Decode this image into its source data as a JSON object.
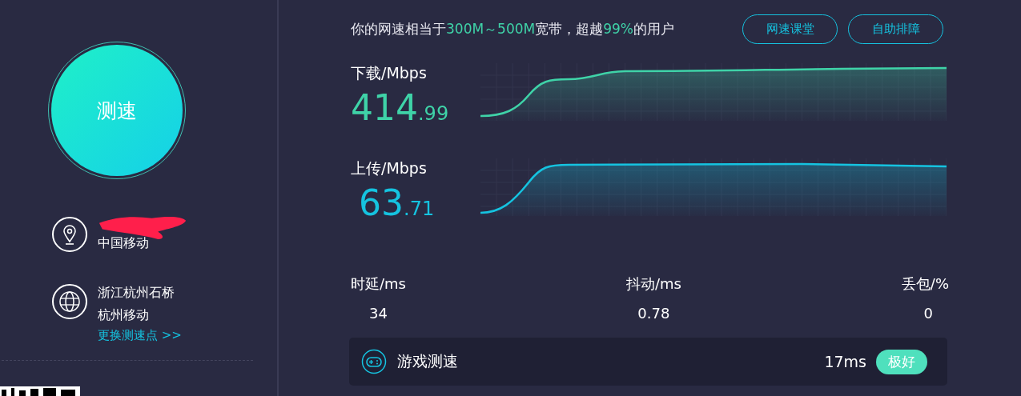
{
  "start_button": {
    "label": "测速"
  },
  "isp_info": {
    "lines": [
      "中国移动"
    ],
    "redacted": true
  },
  "server_info": {
    "lines": [
      "浙江杭州石桥",
      "杭州移动"
    ],
    "link": "更换测速点 >>"
  },
  "summary": {
    "segments": [
      {
        "text": "你的网速相当于",
        "highlight": false
      },
      {
        "text": "300M～500M",
        "highlight": true
      },
      {
        "text": "宽带，超越",
        "highlight": false
      },
      {
        "text": "99%",
        "highlight": true
      },
      {
        "text": "的用户",
        "highlight": false
      }
    ]
  },
  "header_buttons": [
    "网速课堂",
    "自助排障"
  ],
  "speeds": [
    {
      "kind": "download",
      "label": "下载/Mbps",
      "integer": "414",
      "decimal": ".99"
    },
    {
      "kind": "upload",
      "label": "上传/Mbps",
      "integer": "63",
      "decimal": ".71"
    }
  ],
  "stats": [
    {
      "label": "时延/ms",
      "value": "34"
    },
    {
      "label": "抖动/ms",
      "value": "0.78"
    },
    {
      "label": "丢包/%",
      "value": "0"
    }
  ],
  "game_test": {
    "label": "游戏测速",
    "latency": "17ms",
    "rating": "极好"
  }
}
